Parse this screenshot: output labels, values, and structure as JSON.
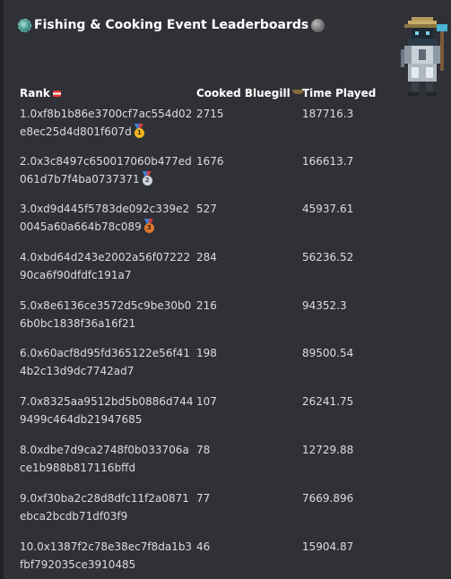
{
  "title": "Fishing & Cooking Event Leaderboards",
  "icons": {
    "title_left": "globe-icon",
    "title_right": "stone-icon",
    "thumbnail": "pixel-character-icon"
  },
  "columns": {
    "rank": "Rank",
    "cooked": "Cooked Bluegill",
    "time": "Time Played"
  },
  "rows": [
    {
      "rank": "1.0xf8b1b86e3700cf7ac554d02e8ec25d4d801f607d",
      "cooked": "2715",
      "time": "187716.3",
      "medal": "gold",
      "medal_num": "1"
    },
    {
      "rank": "2.0x3c8497c650017060b477ed061d7b7f4ba0737371",
      "cooked": "1676",
      "time": "166613.7",
      "medal": "silver",
      "medal_num": "2"
    },
    {
      "rank": "3.0xd9d445f5783de092c339e20045a60a664b78c089",
      "cooked": "527",
      "time": "45937.61",
      "medal": "bronze",
      "medal_num": "3"
    },
    {
      "rank": "4.0xbd64d243e2002a56f0722290ca6f90dfdfc191a7",
      "cooked": "284",
      "time": "56236.52"
    },
    {
      "rank": "5.0x8e6136ce3572d5c9be30b06b0bc1838f36a16f21",
      "cooked": "216",
      "time": "94352.3"
    },
    {
      "rank": "6.0x60acf8d95fd365122e56f414b2c13d9dc7742ad7",
      "cooked": "198",
      "time": "89500.54"
    },
    {
      "rank": "7.0x8325aa9512bd5b0886d7449499c464db21947685",
      "cooked": "107",
      "time": "26241.75"
    },
    {
      "rank": "8.0xdbe7d9ca2748f0b033706ace1b988b817116bffd",
      "cooked": "78",
      "time": "12729.88"
    },
    {
      "rank": "9.0xf30ba2c28d8dfc11f2a0871ebca2bcdb71df03f9",
      "cooked": "77",
      "time": "7669.896"
    },
    {
      "rank": "10.0x1387f2c78e38ec7f8da1b3fbf792035ce3910485",
      "cooked": "46",
      "time": "15904.87"
    }
  ]
}
